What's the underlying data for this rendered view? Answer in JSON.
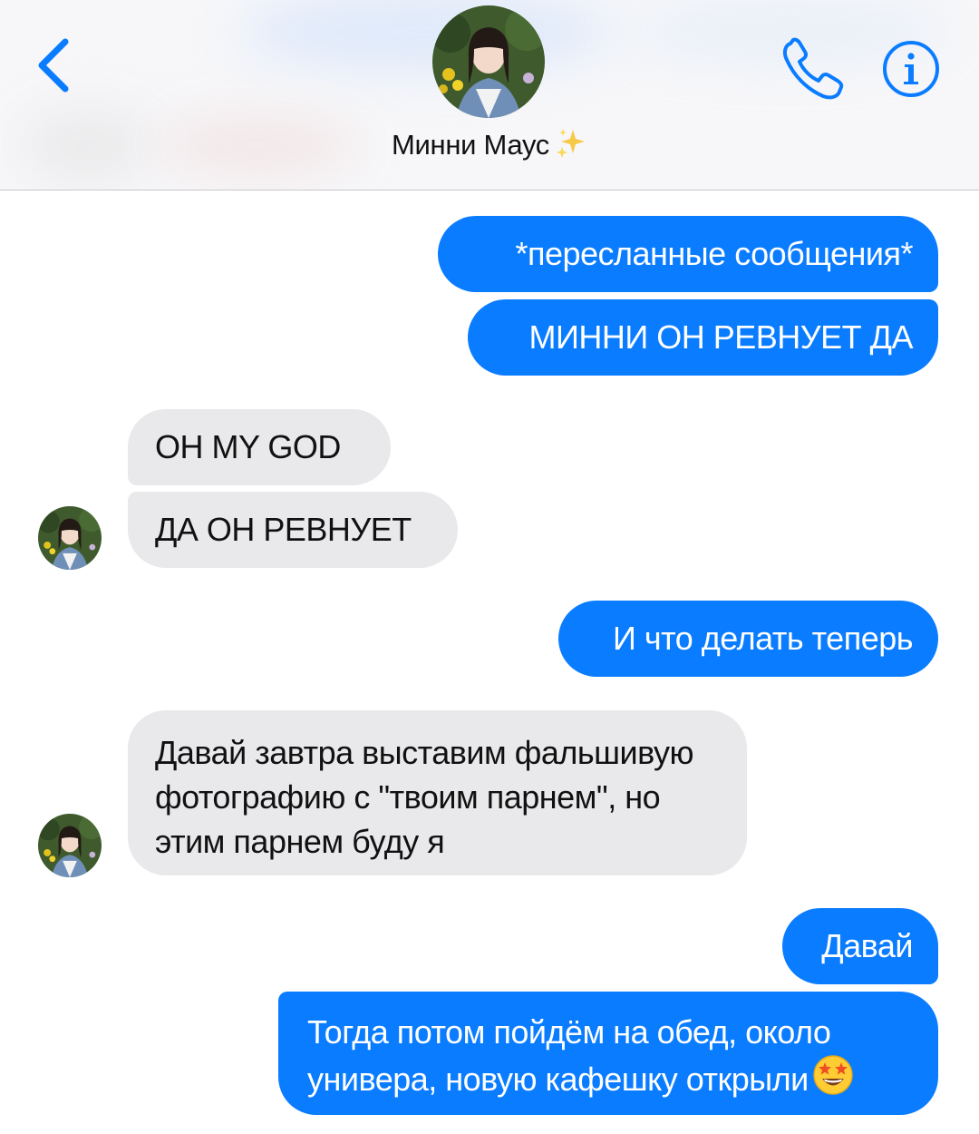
{
  "header": {
    "contact_name": "Минни Маус",
    "name_emoji": "sparkles-icon",
    "back_icon": "chevron-left-icon",
    "call_icon": "phone-icon",
    "info_icon": "info-icon",
    "accent_color": "#0a7cff"
  },
  "messages": [
    {
      "direction": "outgoing",
      "text": "*пересланные сообщения*"
    },
    {
      "direction": "outgoing",
      "text": "МИННИ ОН РЕВНУЕТ ДА"
    },
    {
      "direction": "incoming",
      "text": "OH MY GOD"
    },
    {
      "direction": "incoming",
      "text": "ДА ОН РЕВНУЕТ"
    },
    {
      "direction": "outgoing",
      "text": "И что делать теперь"
    },
    {
      "direction": "incoming",
      "text": "Давай завтра выставим фальшивую фотографию с \"твоим парнем\", но этим парнем буду я"
    },
    {
      "direction": "outgoing",
      "text": "Давай"
    },
    {
      "direction": "outgoing",
      "text": "Тогда потом пойдём на обед, около универа, новую кафешку открыли",
      "emoji": "star-struck-emoji-icon"
    }
  ],
  "colors": {
    "outgoing_bubble": "#0a7cff",
    "incoming_bubble": "#e9e9eb"
  }
}
